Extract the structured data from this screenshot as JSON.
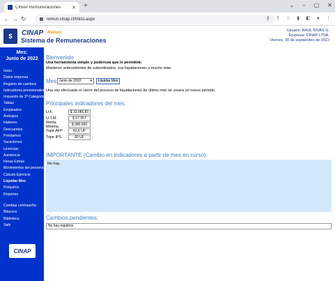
{
  "browser": {
    "tab_title": "CINAP Remuneraciones",
    "url": "remun.cinap.cl/Inicio.aspx"
  },
  "header": {
    "logo_cinap": "CINAP",
    "logo_remun": "Remun",
    "logo_badge": "$",
    "system_title": "Sistema de Remuneraciones",
    "user": "Usuario: RAUL RIVAS G.",
    "company": "Empresa: CINAP LTDA.",
    "date": "Viernes, 30 de septiembre de 2022"
  },
  "sidebar": {
    "mes_label": "Mes:",
    "mes_value": "Junio de 2022",
    "items": [
      "Inicio",
      "Datos empresa",
      "Registro de cambios",
      "Indicadores previsionales",
      "Impuesto de 2ª Categoría",
      "Tablas",
      "Empleados",
      "Anticipos",
      "Haberes",
      "Descuentos",
      "Préstamos",
      "Vacaciones",
      "Licencias",
      "Asistencia",
      "Horas Extras",
      "Movimientos del personal",
      "Cálculo-Ejercicio",
      "Liquidar Mes",
      "Finiquitos",
      "Reportes"
    ],
    "items2": [
      "Cambiar contraseña",
      "Bitacora",
      "Biblioteca",
      "Salir"
    ],
    "footer_logo": "CINAP"
  },
  "main": {
    "welcome": "Bienvenido",
    "tagline": "Una herramienta simple y poderosa que le permitirá:",
    "tagline2": "Mantener antecedentes de subordinados, sus liquidaciones y mucho más.",
    "mes_label": "Mes:",
    "mes_select": "Junio de 2022",
    "liquidar_button": "Liquidar Mes",
    "cierre": "Una vez efectuado el cierre del proceso de liquidaciones de último mes se creara un nuevo periodo.",
    "indicators_title": "Principales indicadores del mes:",
    "indicators": [
      {
        "label": "U.F.",
        "value": "$ 33.086,83"
      },
      {
        "label": "U.T.M.",
        "value": "$ 57.557"
      },
      {
        "label": "Renta Mínima",
        "value": "$ 380.000"
      },
      {
        "label": "Tope AFP",
        "value": "81,6 UF"
      },
      {
        "label": "Tope IPS",
        "value": "60 UF"
      }
    ],
    "important_title": "IMPORTANTE (Cambio en indicadores a partir de mes en curso):",
    "important_text": "No hay.",
    "cambios_title": "Cambios pendientes:",
    "cambios_text": "No hay registros"
  },
  "colors": {
    "sidebar_bg": "#0033cc",
    "heading_blue": "#3a7fc8",
    "important_bg": "#d4e8fb",
    "brand_blue": "#1a3a8f",
    "brand_orange": "#e8a000"
  }
}
